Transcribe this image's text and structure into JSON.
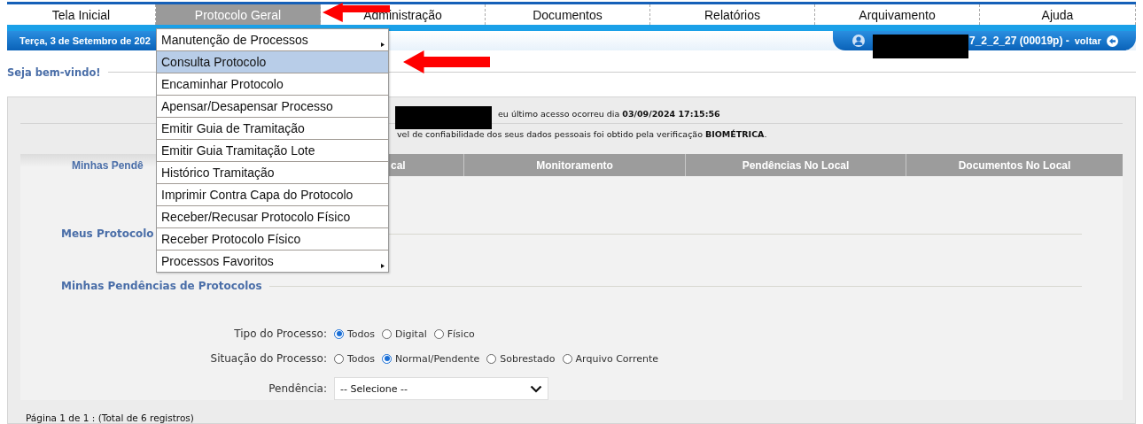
{
  "menu": [
    {
      "label": "Tela Inicial",
      "selected": false
    },
    {
      "label": "Protocolo Geral",
      "selected": true
    },
    {
      "label": "Administração",
      "selected": false
    },
    {
      "label": "Documentos",
      "selected": false
    },
    {
      "label": "Relatórios",
      "selected": false
    },
    {
      "label": "Arquivamento",
      "selected": false
    },
    {
      "label": "Ajuda",
      "selected": false
    }
  ],
  "dropdown": [
    {
      "label": "Manutenção de Processos",
      "selected": false,
      "submenu": true
    },
    {
      "label": "Consulta Protocolo",
      "selected": true,
      "submenu": false
    },
    {
      "label": "Encaminhar Protocolo",
      "selected": false,
      "submenu": false
    },
    {
      "label": "Apensar/Desapensar Processo",
      "selected": false,
      "submenu": false
    },
    {
      "label": "Emitir Guia de Tramitação",
      "selected": false,
      "submenu": false
    },
    {
      "label": "Emitir Guia Tramitação Lote",
      "selected": false,
      "submenu": false
    },
    {
      "label": "Histórico Tramitação",
      "selected": false,
      "submenu": false
    },
    {
      "label": "Imprimir Contra Capa do Protocolo",
      "selected": false,
      "submenu": false
    },
    {
      "label": "Receber/Recusar Protocolo Físico",
      "selected": false,
      "submenu": false
    },
    {
      "label": "Receber Protocolo Físico",
      "selected": false,
      "submenu": false
    },
    {
      "label": "Processos Favoritos",
      "selected": false,
      "submenu": true
    }
  ],
  "date": "Terça, 3 de Setembro de 202",
  "user": {
    "text": "7_2_2_27 (00019p) -",
    "back_link": "voltar"
  },
  "welcome": "Seja bem-vindo!",
  "notices": [
    "eu último acesso ocorreu dia **03/09/2024 17:15:56**",
    "vel de confiabilidade dos seus dados pessoais foi obtido pela verificação **BIOMÉTRICA**."
  ],
  "tabs": [
    {
      "label": "Minhas Pendê",
      "selected": true
    },
    {
      "label": "cal",
      "selected": false
    },
    {
      "label": "Monitoramento",
      "selected": false
    },
    {
      "label": "Pendências No Local",
      "selected": false
    },
    {
      "label": "Documentos No Local",
      "selected": false
    }
  ],
  "sections": [
    "Meus Protocolo",
    "Minhas Pendências de Protocolos"
  ],
  "form": [
    {
      "kind": "radio",
      "label": "Tipo do Processo:",
      "options": [
        {
          "label": "Todos",
          "selected": true
        },
        {
          "label": "Digital",
          "selected": false
        },
        {
          "label": "Físico",
          "selected": false
        }
      ]
    },
    {
      "kind": "radio",
      "label": "Situação do Processo:",
      "options": [
        {
          "label": "Todos",
          "selected": false
        },
        {
          "label": "Normal/Pendente",
          "selected": true
        },
        {
          "label": "Sobrestado",
          "selected": false
        },
        {
          "label": "Arquivo Corrente",
          "selected": false
        }
      ]
    },
    {
      "kind": "select",
      "label": "Pendência:",
      "value": "-- Selecione --"
    }
  ],
  "pagination": "Página 1 de 1 : (Total de 6 registros)"
}
